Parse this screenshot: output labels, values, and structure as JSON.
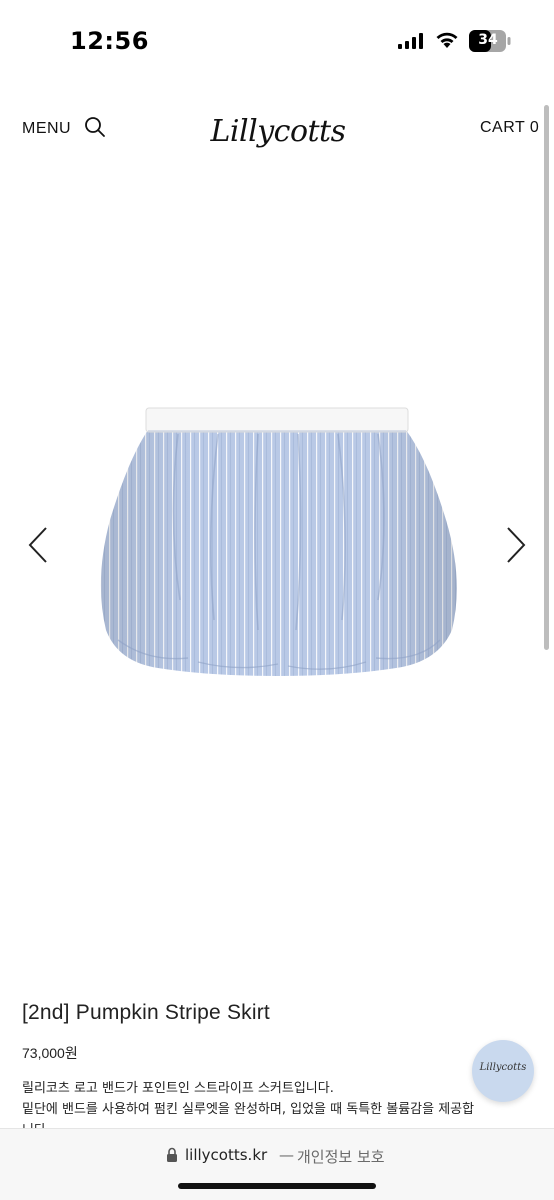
{
  "status_bar": {
    "time": "12:56",
    "battery": "34",
    "icons": [
      "signal-icon",
      "wifi-icon",
      "battery-icon"
    ]
  },
  "header": {
    "menu_label": "MENU",
    "logo_text": "Lillycotts",
    "cart_label": "CART 0",
    "icons": [
      "search-icon"
    ]
  },
  "gallery": {
    "icons": [
      "chevron-left-icon",
      "chevron-right-icon"
    ],
    "image_subject": "skirt",
    "colors": {
      "fabric": "#b9c9e6",
      "stripe": "#ffffff",
      "waistband": "#f7f7f7"
    }
  },
  "product": {
    "title": "[2nd] Pumpkin Stripe Skirt",
    "price": "73,000원",
    "description": [
      "릴리코츠 로고 밴드가 포인트인 스트라이프 스커트입니다.",
      "밑단에 밴드를 사용하여 펌킨 실루엣을 완성하며, 입었을 때 독특한 볼륨감을 제공합",
      "니다."
    ]
  },
  "floating_badge": {
    "text": "Lillycotts"
  },
  "browser": {
    "url": "lillycotts.kr",
    "separator": "—",
    "privacy": "개인정보 보호",
    "icons": [
      "lock-icon"
    ]
  }
}
